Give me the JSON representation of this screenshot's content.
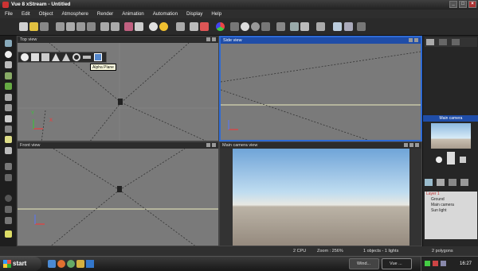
{
  "window": {
    "title": "Vue 8 xStream - Untitled"
  },
  "menu": [
    "File",
    "Edit",
    "Object",
    "Atmosphere",
    "Render",
    "Animation",
    "Automation",
    "Display",
    "Help"
  ],
  "viewports": {
    "top": {
      "title": "Top view"
    },
    "side": {
      "title": "Side view"
    },
    "front": {
      "title": "Front view"
    },
    "camera": {
      "title": "Main camera view"
    }
  },
  "tooltip": "Alpha Plane",
  "right_panel": {
    "camera_preview_title": "Main camera",
    "layers": [
      {
        "label": "Layer 1",
        "color": "#e06060",
        "indent": 0
      },
      {
        "label": "Ground",
        "color": "#cccccc",
        "indent": 1
      },
      {
        "label": "Main camera",
        "color": "#cccccc",
        "indent": 1
      },
      {
        "label": "Sun light",
        "color": "#cccccc",
        "indent": 1
      }
    ]
  },
  "status": {
    "cpu": "2 CPU",
    "zoom": "Zoom : 256%",
    "objects": "1 objects - 1 lights",
    "polygons": "2 polygons"
  },
  "taskbar": {
    "start_label": "start",
    "tasks": [
      "Wind...",
      "Vue ..."
    ],
    "clock": "16:27"
  },
  "colors": {
    "accent": "#2e6bd6",
    "horizon_line": "#d8d8b0",
    "axis_x": "#ff3333",
    "axis_y": "#33cc33",
    "axis_z": "#5577ff"
  }
}
